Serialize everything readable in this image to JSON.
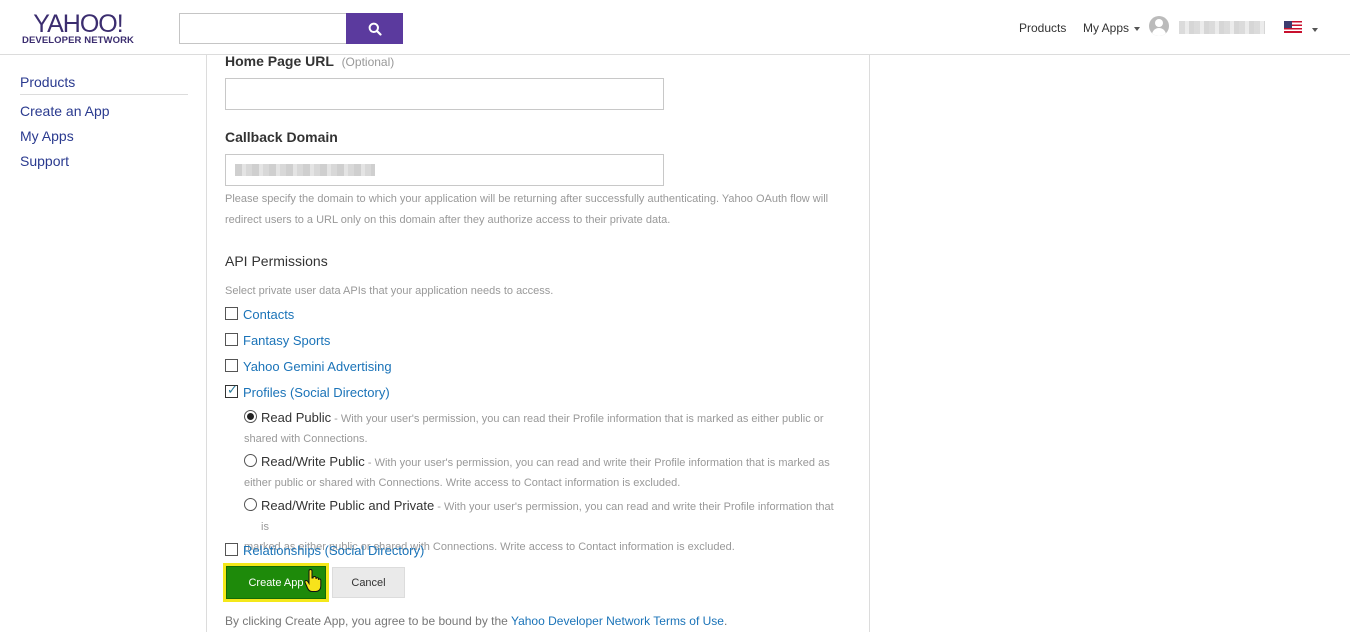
{
  "header": {
    "logo_main": "YAHOO!",
    "logo_sub": "DEVELOPER NETWORK",
    "search": {
      "value": "",
      "placeholder": ""
    },
    "nav": {
      "products": "Products",
      "my_apps": "My Apps"
    },
    "accent_color": "#5b3a9e"
  },
  "sidebar": {
    "items": [
      {
        "label": "Products"
      },
      {
        "label": "Create an App"
      },
      {
        "label": "My Apps"
      },
      {
        "label": "Support"
      }
    ]
  },
  "form": {
    "home_page_url": {
      "label": "Home Page URL",
      "optional": "(Optional)",
      "value": ""
    },
    "callback_domain": {
      "label": "Callback Domain",
      "help_line1": "Please specify the domain to which your application will be returning after successfully authenticating. Yahoo OAuth flow will",
      "help_line2": "redirect users to a URL only on this domain after they authorize access to their private data."
    },
    "api_permissions": {
      "title": "API Permissions",
      "help": "Select private user data APIs that your application needs to access.",
      "items": [
        {
          "label": "Contacts",
          "checked": false
        },
        {
          "label": "Fantasy Sports",
          "checked": false
        },
        {
          "label": "Yahoo Gemini Advertising",
          "checked": false
        },
        {
          "label": "Profiles (Social Directory)",
          "checked": true
        },
        {
          "label": "Relationships (Social Directory)",
          "checked": false
        }
      ],
      "profile_options": [
        {
          "label": "Read Public",
          "selected": true,
          "desc1": " - With your user's permission, you can read their Profile information that is marked as either public or",
          "desc2": "shared with Connections."
        },
        {
          "label": "Read/Write Public",
          "selected": false,
          "desc1": " - With your user's permission, you can read and write their Profile information that is marked as",
          "desc2": "either public or shared with Connections. Write access to Contact information is excluded."
        },
        {
          "label": "Read/Write Public and Private",
          "selected": false,
          "desc1": " - With your user's permission, you can read and write their Profile information that is",
          "desc2": "marked as either public or shared with Connections. Write access to Contact information is excluded."
        }
      ]
    },
    "buttons": {
      "create": "Create App",
      "cancel": "Cancel"
    },
    "terms": {
      "prefix": "By clicking Create App, you agree to be bound by the ",
      "link": "Yahoo Developer Network Terms of Use",
      "suffix": "."
    },
    "create_button_color": "#1e8a0a",
    "highlight_color": "#f4e81a"
  }
}
